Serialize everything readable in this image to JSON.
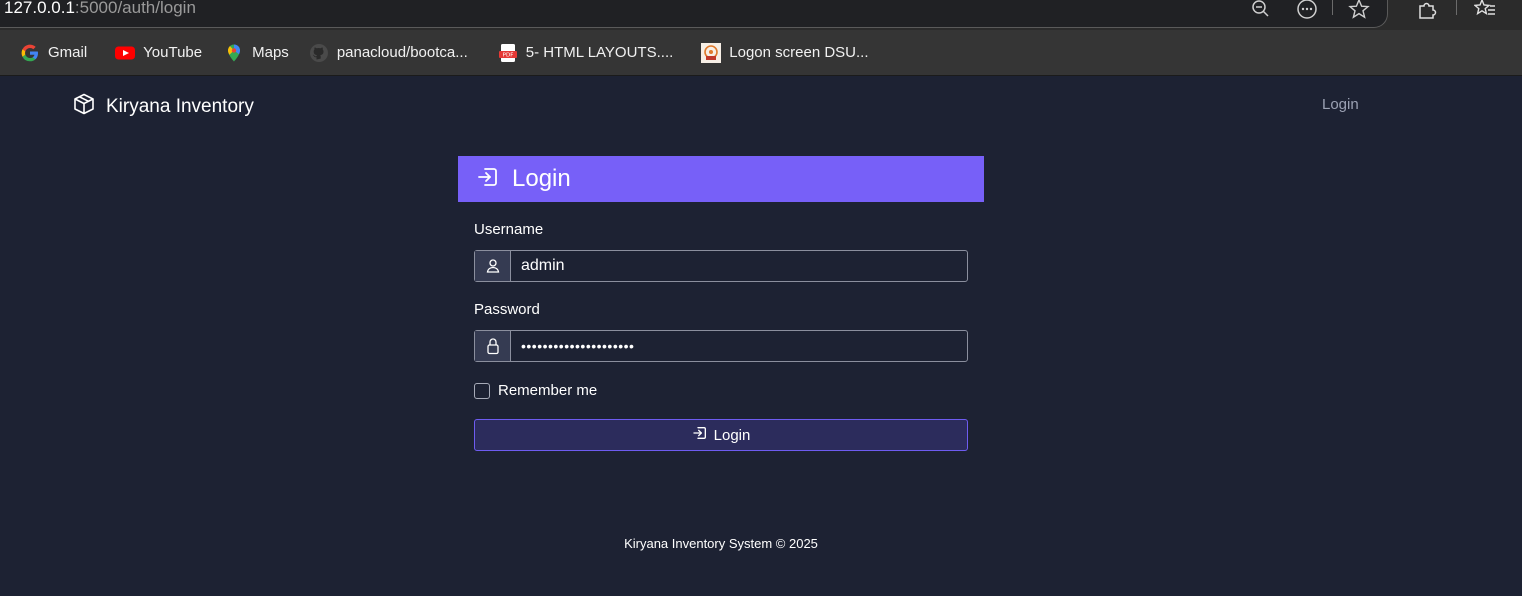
{
  "browser": {
    "url_host": "127.0.0.1",
    "url_path": ":5000/auth/login",
    "bookmarks": [
      {
        "label": "Gmail",
        "icon": "google-icon"
      },
      {
        "label": "YouTube",
        "icon": "youtube-icon"
      },
      {
        "label": "Maps",
        "icon": "maps-icon"
      },
      {
        "label": "panacloud/bootca...",
        "icon": "github-icon"
      },
      {
        "label": "5- HTML LAYOUTS....",
        "icon": "pdf-icon"
      },
      {
        "label": "Logon screen DSU...",
        "icon": "site-icon"
      }
    ]
  },
  "navbar": {
    "brand": "Kiryana Inventory",
    "login_link": "Login"
  },
  "card": {
    "title": "Login",
    "username_label": "Username",
    "username_value": "admin",
    "password_label": "Password",
    "password_value": "•••••••••••••••••••••",
    "remember_label": "Remember me",
    "remember_checked": false,
    "submit_label": "Login"
  },
  "footer": {
    "text": "Kiryana Inventory System © 2025"
  },
  "colors": {
    "background": "#1d2233",
    "accent": "#7760f8",
    "button_bg": "#2c2c5c"
  }
}
